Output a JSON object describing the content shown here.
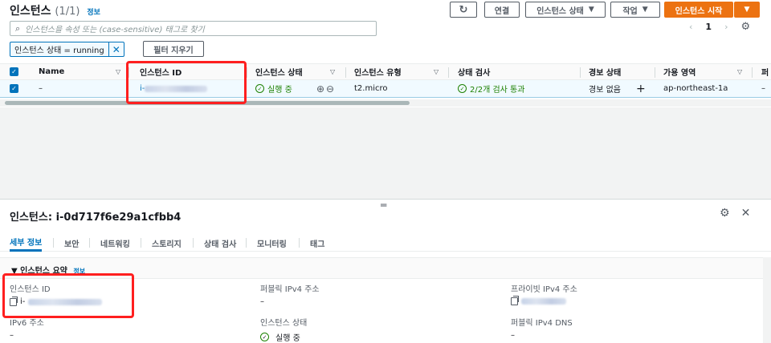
{
  "header": {
    "title": "인스턴스",
    "count": "(1/1)",
    "info": "정보"
  },
  "toolbar": {
    "refresh_icon": "refresh-icon",
    "connect": "연결",
    "instance_state": "인스턴스 상태",
    "actions": "작업",
    "launch": "인스턴스 시작"
  },
  "search": {
    "placeholder": "인스턴스을 속성 또는 (case-sensitive) 태그로 찾기"
  },
  "pagination": {
    "page": "1"
  },
  "filter": {
    "token": "인스턴스 상태 = running",
    "clear": "필터 지우기"
  },
  "table": {
    "columns": [
      "Name",
      "인스턴스 ID",
      "인스턴스 상태",
      "인스턴스 유형",
      "상태 검사",
      "경보 상태",
      "가용 영역",
      "퍼"
    ],
    "row": {
      "name": "–",
      "instance_id_prefix": "i-",
      "state": "실행 중",
      "type": "t2.micro",
      "status_check": "2/2개 검사 통과",
      "alarm": "경보 없음",
      "alarm_add": "+",
      "az": "ap-northeast-1a",
      "extra": "–"
    }
  },
  "detail": {
    "title": "인스턴스: i-0d717f6e29a1cfbb4",
    "tabs": [
      "세부 정보",
      "보안",
      "네트워킹",
      "스토리지",
      "상태 검사",
      "모니터링",
      "태그"
    ],
    "section_title": "▼ 인스턴스 요약",
    "section_info": "정보",
    "fields": {
      "instance_id_label": "인스턴스 ID",
      "instance_id_prefix": "i-",
      "public_ipv4_label": "퍼블릭 IPv4 주소",
      "public_ipv4_value": "–",
      "private_ipv4_label": "프라이빗 IPv4 주소",
      "ipv6_label": "IPv6 주소",
      "ipv6_value": "–",
      "state_label": "인스턴스 상태",
      "state_value": "실행 중",
      "public_dns_label": "퍼블릭 IPv4 DNS",
      "public_dns_value": "–"
    }
  },
  "colors": {
    "accent": "#0073bb",
    "primary": "#ec7211",
    "success": "#1d8102",
    "highlight": "#ff1f1f"
  }
}
